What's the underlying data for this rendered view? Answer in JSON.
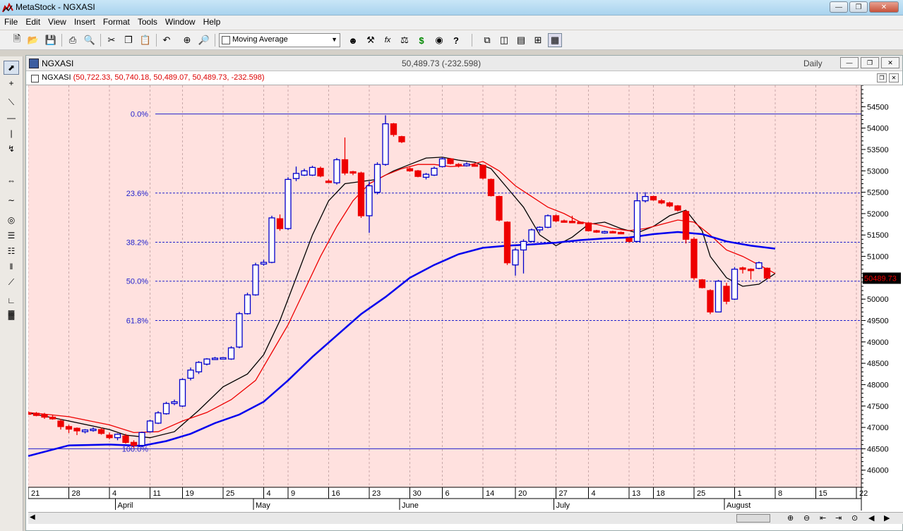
{
  "window": {
    "title": "MetaStock - NGXASI"
  },
  "menu": [
    "File",
    "Edit",
    "View",
    "Insert",
    "Format",
    "Tools",
    "Window",
    "Help"
  ],
  "toolbar": {
    "indicator_select": "Moving Average"
  },
  "doc": {
    "name": "NGXASI",
    "last_price": "50,489.73 (-232.598)",
    "period": "Daily",
    "pane_label": "NGXASI",
    "pane_values": "(50,722.33, 50,740.18, 50,489.07, 50,489.73, -232.598)"
  },
  "colors": {
    "chart_bg": "#ffe1df",
    "up_candle": "#0000cc",
    "down_candle": "#ee0000",
    "ma_fast": "#000000",
    "ma_mid": "#ee0000",
    "ma_slow": "#0000ee",
    "fib_line": "#2222cc",
    "price_marker": "#ee0000"
  },
  "chart_data": {
    "type": "candlestick",
    "symbol": "NGXASI",
    "ylim": [
      45600,
      55000
    ],
    "y_ticks": [
      46000,
      46500,
      47000,
      47500,
      48000,
      48500,
      49000,
      49500,
      50000,
      50500,
      51000,
      51500,
      52000,
      52500,
      53000,
      53500,
      54000,
      54500
    ],
    "y_tick_labels": [
      "46000",
      "46500",
      "47000",
      "47500",
      "48000",
      "48500",
      "49000",
      "49500",
      "50000",
      "50500",
      "51000",
      "51500",
      "52000",
      "52500",
      "53000",
      "53500",
      "54000",
      "54500"
    ],
    "x_ticks": [
      {
        "label": "21",
        "day": 0
      },
      {
        "label": "28",
        "day": 5
      },
      {
        "label": "4",
        "day": 10
      },
      {
        "label": "11",
        "day": 15
      },
      {
        "label": "19",
        "day": 19
      },
      {
        "label": "25",
        "day": 24
      },
      {
        "label": "4",
        "day": 29
      },
      {
        "label": "9",
        "day": 32
      },
      {
        "label": "16",
        "day": 37
      },
      {
        "label": "23",
        "day": 42
      },
      {
        "label": "30",
        "day": 47
      },
      {
        "label": "6",
        "day": 51
      },
      {
        "label": "14",
        "day": 56
      },
      {
        "label": "20",
        "day": 60
      },
      {
        "label": "27",
        "day": 65
      },
      {
        "label": "4",
        "day": 69
      },
      {
        "label": "13",
        "day": 74
      },
      {
        "label": "18",
        "day": 77
      },
      {
        "label": "25",
        "day": 82
      },
      {
        "label": "1",
        "day": 87
      },
      {
        "label": "8",
        "day": 92
      },
      {
        "label": "15",
        "day": 97
      },
      {
        "label": "22",
        "day": 102
      }
    ],
    "months": [
      {
        "label": "April",
        "day": 11
      },
      {
        "label": "May",
        "day": 28
      },
      {
        "label": "June",
        "day": 46
      },
      {
        "label": "July",
        "day": 65
      },
      {
        "label": "August",
        "day": 86
      }
    ],
    "fibonacci": [
      {
        "label": "0.0%",
        "value": 54330
      },
      {
        "label": "23.6%",
        "value": 52480
      },
      {
        "label": "38.2%",
        "value": 51330
      },
      {
        "label": "50.0%",
        "value": 50420
      },
      {
        "label": "61.8%",
        "value": 49500
      },
      {
        "label": "100.0%",
        "value": 46500
      }
    ],
    "last_value": "50489.73",
    "candles": [
      {
        "o": 47340,
        "h": 47380,
        "l": 47300,
        "c": 47330
      },
      {
        "o": 47330,
        "h": 47360,
        "l": 47260,
        "c": 47280
      },
      {
        "o": 47300,
        "h": 47340,
        "l": 47200,
        "c": 47240
      },
      {
        "o": 47240,
        "h": 47300,
        "l": 47180,
        "c": 47200
      },
      {
        "o": 47150,
        "h": 47200,
        "l": 46950,
        "c": 47020
      },
      {
        "o": 47020,
        "h": 47060,
        "l": 46870,
        "c": 46960
      },
      {
        "o": 46980,
        "h": 47000,
        "l": 46820,
        "c": 46920
      },
      {
        "o": 46900,
        "h": 46960,
        "l": 46860,
        "c": 46940
      },
      {
        "o": 46950,
        "h": 47000,
        "l": 46900,
        "c": 46960
      },
      {
        "o": 46950,
        "h": 47000,
        "l": 46830,
        "c": 46860
      },
      {
        "o": 46820,
        "h": 46880,
        "l": 46720,
        "c": 46760
      },
      {
        "o": 46760,
        "h": 46860,
        "l": 46700,
        "c": 46840
      },
      {
        "o": 46800,
        "h": 46850,
        "l": 46620,
        "c": 46650
      },
      {
        "o": 46650,
        "h": 46700,
        "l": 46520,
        "c": 46580
      },
      {
        "o": 46580,
        "h": 46900,
        "l": 46540,
        "c": 46880
      },
      {
        "o": 46900,
        "h": 47180,
        "l": 46880,
        "c": 47150
      },
      {
        "o": 47100,
        "h": 47380,
        "l": 47080,
        "c": 47340
      },
      {
        "o": 47320,
        "h": 47600,
        "l": 47300,
        "c": 47560
      },
      {
        "o": 47560,
        "h": 47650,
        "l": 47520,
        "c": 47600
      },
      {
        "o": 47500,
        "h": 48150,
        "l": 47480,
        "c": 48120
      },
      {
        "o": 48150,
        "h": 48400,
        "l": 48100,
        "c": 48340
      },
      {
        "o": 48300,
        "h": 48550,
        "l": 48250,
        "c": 48520
      },
      {
        "o": 48480,
        "h": 48620,
        "l": 48450,
        "c": 48600
      },
      {
        "o": 48600,
        "h": 48650,
        "l": 48580,
        "c": 48620
      },
      {
        "o": 48620,
        "h": 48640,
        "l": 48600,
        "c": 48630
      },
      {
        "o": 48600,
        "h": 48900,
        "l": 48580,
        "c": 48860
      },
      {
        "o": 48880,
        "h": 49700,
        "l": 48850,
        "c": 49660
      },
      {
        "o": 49660,
        "h": 50150,
        "l": 49640,
        "c": 50100
      },
      {
        "o": 50100,
        "h": 50850,
        "l": 50080,
        "c": 50800
      },
      {
        "o": 50820,
        "h": 50920,
        "l": 50780,
        "c": 50860
      },
      {
        "o": 50860,
        "h": 51950,
        "l": 50840,
        "c": 51900
      },
      {
        "o": 51880,
        "h": 51980,
        "l": 51600,
        "c": 51650
      },
      {
        "o": 51650,
        "h": 52850,
        "l": 51620,
        "c": 52800
      },
      {
        "o": 52820,
        "h": 53100,
        "l": 52760,
        "c": 52940
      },
      {
        "o": 52900,
        "h": 53050,
        "l": 52880,
        "c": 53000
      },
      {
        "o": 52900,
        "h": 53120,
        "l": 52880,
        "c": 53080
      },
      {
        "o": 53060,
        "h": 53100,
        "l": 52850,
        "c": 52880
      },
      {
        "o": 52760,
        "h": 52800,
        "l": 52720,
        "c": 52750
      },
      {
        "o": 52720,
        "h": 53300,
        "l": 52680,
        "c": 53260
      },
      {
        "o": 53260,
        "h": 53780,
        "l": 52900,
        "c": 52950
      },
      {
        "o": 52980,
        "h": 53000,
        "l": 52900,
        "c": 52960
      },
      {
        "o": 52950,
        "h": 52980,
        "l": 51900,
        "c": 51950
      },
      {
        "o": 51950,
        "h": 52750,
        "l": 51550,
        "c": 52650
      },
      {
        "o": 52500,
        "h": 53200,
        "l": 52450,
        "c": 53150
      },
      {
        "o": 53150,
        "h": 54300,
        "l": 53120,
        "c": 54100
      },
      {
        "o": 54100,
        "h": 54120,
        "l": 53800,
        "c": 53850
      },
      {
        "o": 53800,
        "h": 53820,
        "l": 53650,
        "c": 53680
      },
      {
        "o": 53050,
        "h": 53080,
        "l": 52980,
        "c": 53000
      },
      {
        "o": 53000,
        "h": 53020,
        "l": 52850,
        "c": 52870
      },
      {
        "o": 52850,
        "h": 52950,
        "l": 52800,
        "c": 52920
      },
      {
        "o": 52900,
        "h": 53100,
        "l": 52880,
        "c": 53060
      },
      {
        "o": 53100,
        "h": 53320,
        "l": 53080,
        "c": 53280
      },
      {
        "o": 53280,
        "h": 53300,
        "l": 53150,
        "c": 53170
      },
      {
        "o": 53150,
        "h": 53180,
        "l": 53080,
        "c": 53120
      },
      {
        "o": 53120,
        "h": 53200,
        "l": 53100,
        "c": 53160
      },
      {
        "o": 53140,
        "h": 53180,
        "l": 53100,
        "c": 53130
      },
      {
        "o": 53130,
        "h": 53150,
        "l": 52800,
        "c": 52830
      },
      {
        "o": 52800,
        "h": 52820,
        "l": 52400,
        "c": 52420
      },
      {
        "o": 52400,
        "h": 52420,
        "l": 51820,
        "c": 51850
      },
      {
        "o": 51800,
        "h": 51820,
        "l": 50800,
        "c": 50850
      },
      {
        "o": 50800,
        "h": 51200,
        "l": 50550,
        "c": 51150
      },
      {
        "o": 51150,
        "h": 51400,
        "l": 50600,
        "c": 51350
      },
      {
        "o": 51350,
        "h": 51650,
        "l": 51330,
        "c": 51620
      },
      {
        "o": 51620,
        "h": 51700,
        "l": 51560,
        "c": 51680
      },
      {
        "o": 51680,
        "h": 51980,
        "l": 51660,
        "c": 51950
      },
      {
        "o": 51950,
        "h": 51980,
        "l": 51800,
        "c": 51830
      },
      {
        "o": 51830,
        "h": 51860,
        "l": 51800,
        "c": 51820
      },
      {
        "o": 51820,
        "h": 51950,
        "l": 51780,
        "c": 51810
      },
      {
        "o": 51800,
        "h": 51820,
        "l": 51780,
        "c": 51790
      },
      {
        "o": 51780,
        "h": 51800,
        "l": 51580,
        "c": 51600
      },
      {
        "o": 51600,
        "h": 51620,
        "l": 51550,
        "c": 51580
      },
      {
        "o": 51560,
        "h": 51600,
        "l": 51530,
        "c": 51580
      },
      {
        "o": 51580,
        "h": 51600,
        "l": 51540,
        "c": 51560
      },
      {
        "o": 51560,
        "h": 51580,
        "l": 51530,
        "c": 51550
      },
      {
        "o": 51420,
        "h": 51450,
        "l": 51330,
        "c": 51350
      },
      {
        "o": 51350,
        "h": 52500,
        "l": 51340,
        "c": 52300
      },
      {
        "o": 52300,
        "h": 52500,
        "l": 52260,
        "c": 52400
      },
      {
        "o": 52400,
        "h": 52420,
        "l": 52300,
        "c": 52320
      },
      {
        "o": 52300,
        "h": 52340,
        "l": 52220,
        "c": 52250
      },
      {
        "o": 52250,
        "h": 52280,
        "l": 52150,
        "c": 52180
      },
      {
        "o": 52180,
        "h": 52200,
        "l": 52050,
        "c": 52080
      },
      {
        "o": 52050,
        "h": 52080,
        "l": 51300,
        "c": 51400
      },
      {
        "o": 51400,
        "h": 51450,
        "l": 50450,
        "c": 50500
      },
      {
        "o": 50450,
        "h": 50470,
        "l": 50250,
        "c": 50270
      },
      {
        "o": 50200,
        "h": 50230,
        "l": 49650,
        "c": 49700
      },
      {
        "o": 49700,
        "h": 50450,
        "l": 49690,
        "c": 50420
      },
      {
        "o": 50300,
        "h": 50380,
        "l": 49880,
        "c": 49950
      },
      {
        "o": 50000,
        "h": 50750,
        "l": 49980,
        "c": 50700
      },
      {
        "o": 50730,
        "h": 50760,
        "l": 50600,
        "c": 50720
      },
      {
        "o": 50700,
        "h": 50720,
        "l": 50460,
        "c": 50690
      },
      {
        "o": 50720,
        "h": 50880,
        "l": 50700,
        "c": 50850
      },
      {
        "o": 50722.33,
        "h": 50740.18,
        "l": 50489.07,
        "c": 50489.73
      }
    ],
    "series": [
      {
        "name": "",
        "color": "#000000",
        "points": [
          [
            0,
            47340
          ],
          [
            5,
            47150
          ],
          [
            10,
            46950
          ],
          [
            12,
            46820
          ],
          [
            15,
            46760
          ],
          [
            18,
            46900
          ],
          [
            21,
            47400
          ],
          [
            24,
            47950
          ],
          [
            27,
            48250
          ],
          [
            29,
            48700
          ],
          [
            31,
            49500
          ],
          [
            33,
            50500
          ],
          [
            35,
            51500
          ],
          [
            37,
            52300
          ],
          [
            39,
            52700
          ],
          [
            41,
            52750
          ],
          [
            43,
            52800
          ],
          [
            45,
            53000
          ],
          [
            47,
            53150
          ],
          [
            49,
            53300
          ],
          [
            51,
            53320
          ],
          [
            53,
            53250
          ],
          [
            55,
            53200
          ],
          [
            57,
            53050
          ],
          [
            59,
            52600
          ],
          [
            61,
            52150
          ],
          [
            63,
            51500
          ],
          [
            65,
            51250
          ],
          [
            67,
            51450
          ],
          [
            69,
            51750
          ],
          [
            71,
            51800
          ],
          [
            73,
            51650
          ],
          [
            75,
            51550
          ],
          [
            77,
            51700
          ],
          [
            79,
            51950
          ],
          [
            81,
            52080
          ],
          [
            83,
            51600
          ],
          [
            84,
            51000
          ],
          [
            86,
            50500
          ],
          [
            88,
            50300
          ],
          [
            90,
            50350
          ],
          [
            92,
            50600
          ]
        ]
      },
      {
        "name": "",
        "color": "#ee0000",
        "points": [
          [
            0,
            47350
          ],
          [
            5,
            47250
          ],
          [
            10,
            47060
          ],
          [
            13,
            46880
          ],
          [
            16,
            46900
          ],
          [
            19,
            47150
          ],
          [
            22,
            47350
          ],
          [
            25,
            47650
          ],
          [
            28,
            48100
          ],
          [
            30,
            48750
          ],
          [
            32,
            49400
          ],
          [
            34,
            50200
          ],
          [
            36,
            51000
          ],
          [
            38,
            51700
          ],
          [
            40,
            52300
          ],
          [
            42,
            52700
          ],
          [
            44,
            52900
          ],
          [
            46,
            53050
          ],
          [
            48,
            53150
          ],
          [
            50,
            53150
          ],
          [
            52,
            53100
          ],
          [
            54,
            53120
          ],
          [
            56,
            53220
          ],
          [
            58,
            53000
          ],
          [
            60,
            52650
          ],
          [
            62,
            52400
          ],
          [
            64,
            52150
          ],
          [
            66,
            52000
          ],
          [
            68,
            51800
          ],
          [
            70,
            51750
          ],
          [
            72,
            51650
          ],
          [
            74,
            51600
          ],
          [
            76,
            51650
          ],
          [
            78,
            51750
          ],
          [
            80,
            51850
          ],
          [
            82,
            51800
          ],
          [
            84,
            51500
          ],
          [
            86,
            51150
          ],
          [
            88,
            51000
          ],
          [
            90,
            50800
          ],
          [
            92,
            50600
          ]
        ]
      },
      {
        "name": "",
        "color": "#0000ee",
        "points": [
          [
            0,
            46330
          ],
          [
            5,
            46580
          ],
          [
            10,
            46600
          ],
          [
            14,
            46570
          ],
          [
            17,
            46680
          ],
          [
            20,
            46850
          ],
          [
            23,
            47100
          ],
          [
            26,
            47300
          ],
          [
            29,
            47600
          ],
          [
            32,
            48100
          ],
          [
            35,
            48650
          ],
          [
            38,
            49150
          ],
          [
            41,
            49650
          ],
          [
            44,
            50050
          ],
          [
            47,
            50500
          ],
          [
            50,
            50800
          ],
          [
            53,
            51050
          ],
          [
            56,
            51200
          ],
          [
            59,
            51250
          ],
          [
            62,
            51280
          ],
          [
            65,
            51320
          ],
          [
            68,
            51380
          ],
          [
            71,
            51420
          ],
          [
            74,
            51440
          ],
          [
            77,
            51520
          ],
          [
            80,
            51570
          ],
          [
            83,
            51520
          ],
          [
            86,
            51350
          ],
          [
            89,
            51250
          ],
          [
            92,
            51180
          ]
        ]
      }
    ],
    "grid": true,
    "legend": "none"
  }
}
